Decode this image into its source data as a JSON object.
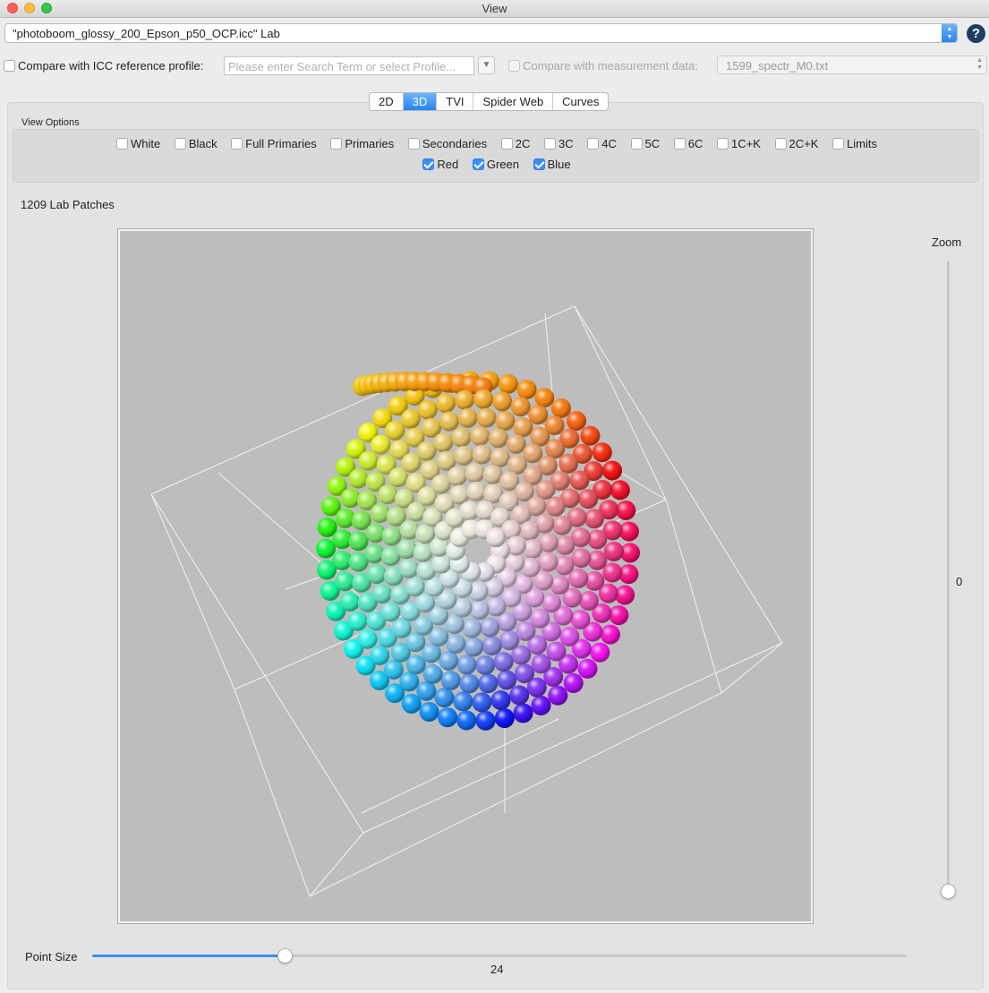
{
  "window": {
    "title": "View"
  },
  "profile": {
    "selected": "\"photoboom_glossy_200_Epson_p50_OCP.icc\" Lab",
    "help_label": "?"
  },
  "compare_icc": {
    "label": "Compare with ICC reference profile:",
    "checked": false,
    "placeholder": "Please enter Search Term or select Profile..."
  },
  "compare_measurement": {
    "label": "Compare with measurement data:",
    "checked": false,
    "file": "1599_spectr_M0.txt"
  },
  "tabs": [
    {
      "label": "2D",
      "active": false
    },
    {
      "label": "3D",
      "active": true
    },
    {
      "label": "TVI",
      "active": false
    },
    {
      "label": "Spider Web",
      "active": false
    },
    {
      "label": "Curves",
      "active": false
    }
  ],
  "view_options": {
    "caption": "View Options",
    "row1": [
      {
        "label": "White",
        "checked": false
      },
      {
        "label": "Black",
        "checked": false
      },
      {
        "label": "Full Primaries",
        "checked": false
      },
      {
        "label": "Primaries",
        "checked": false
      },
      {
        "label": "Secondaries",
        "checked": false
      },
      {
        "label": "2C",
        "checked": false
      },
      {
        "label": "3C",
        "checked": false
      },
      {
        "label": "4C",
        "checked": false
      },
      {
        "label": "5C",
        "checked": false
      },
      {
        "label": "6C",
        "checked": false
      },
      {
        "label": "1C+K",
        "checked": false
      },
      {
        "label": "2C+K",
        "checked": false
      },
      {
        "label": "Limits",
        "checked": false
      }
    ],
    "row2": [
      {
        "label": "Red",
        "checked": true
      },
      {
        "label": "Green",
        "checked": true
      },
      {
        "label": "Blue",
        "checked": true
      }
    ]
  },
  "patch_count": "1209 Lab Patches",
  "zoom": {
    "label": "Zoom",
    "value": "0"
  },
  "point_size": {
    "label": "Point Size",
    "value": "24",
    "fraction": 0.23
  },
  "colors": {
    "accent": "#3b8ff6",
    "viewport_bg": "#bdbdbd"
  }
}
